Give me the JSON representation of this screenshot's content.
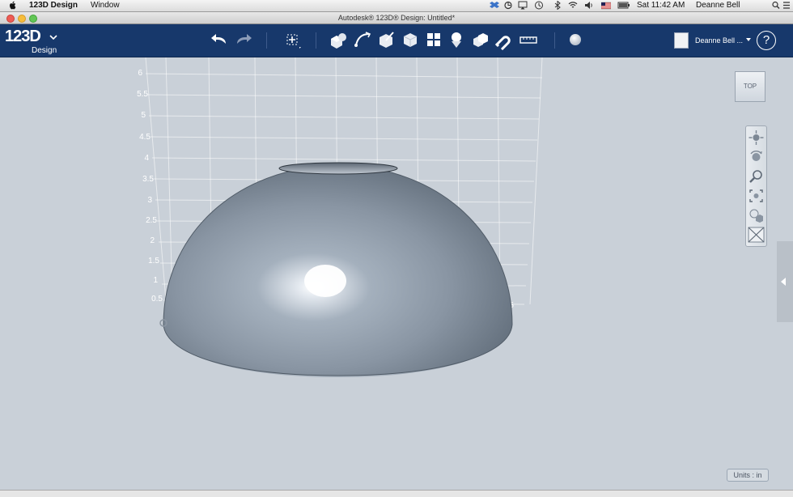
{
  "menubar": {
    "app_name": "123D Design",
    "window_menu": "Window",
    "time": "Sat 11:42 AM",
    "user": "Deanne Bell"
  },
  "window": {
    "title": "Autodesk® 123D® Design: Untitled*"
  },
  "toolbar": {
    "logo_main": "123D",
    "logo_sub": "Design",
    "user_name": "Deanne Bell ...",
    "help_label": "?"
  },
  "viewport": {
    "y_axis_ticks": [
      "6",
      "5.5",
      "5",
      "4.5",
      "4",
      "3.5",
      "3",
      "2.5",
      "2",
      "1.5",
      "1",
      "0.5"
    ],
    "x_axis_tick": "0.5",
    "viewcube_label": "TOP",
    "units_label": "Units : in"
  },
  "colors": {
    "toolbar_bg": "#17386b",
    "viewport_bg": "#c9d0d8",
    "model_color": "#8d9aa8"
  }
}
